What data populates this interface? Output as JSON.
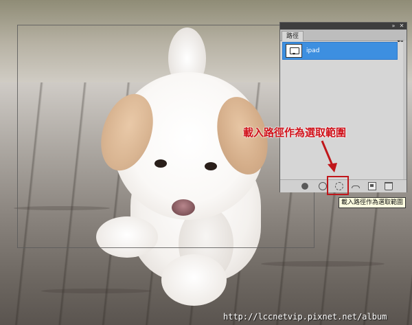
{
  "panel": {
    "tab_label": "路徑",
    "collapse_icon": "double-chevron-right-icon",
    "close_icon": "close-icon",
    "menu_icon": "panel-menu-icon",
    "paths": [
      {
        "name": "ipad",
        "thumbnail_icon": "speech-bubble-path-thumbnail",
        "selected": true
      }
    ],
    "bottom_buttons": [
      {
        "id": "fill-path",
        "icon": "fill-path-icon"
      },
      {
        "id": "stroke-path",
        "icon": "stroke-path-icon"
      },
      {
        "id": "load-path-as-selection",
        "icon": "load-path-as-selection-icon",
        "highlighted": true
      },
      {
        "id": "make-work-path",
        "icon": "make-work-path-icon"
      },
      {
        "id": "create-new-path",
        "icon": "create-new-path-icon"
      },
      {
        "id": "delete-path",
        "icon": "delete-path-icon"
      }
    ],
    "tooltip": "載入路徑作為選取範圍"
  },
  "annotation": {
    "label": "載入路徑作為選取範圍",
    "color": "#d0121b"
  },
  "watermark": "http://lccnetvip.pixnet.net/album",
  "colors": {
    "selection_blue": "#3d8fe0",
    "highlight_red": "#c0161a",
    "panel_bg": "#d6d6d6"
  }
}
